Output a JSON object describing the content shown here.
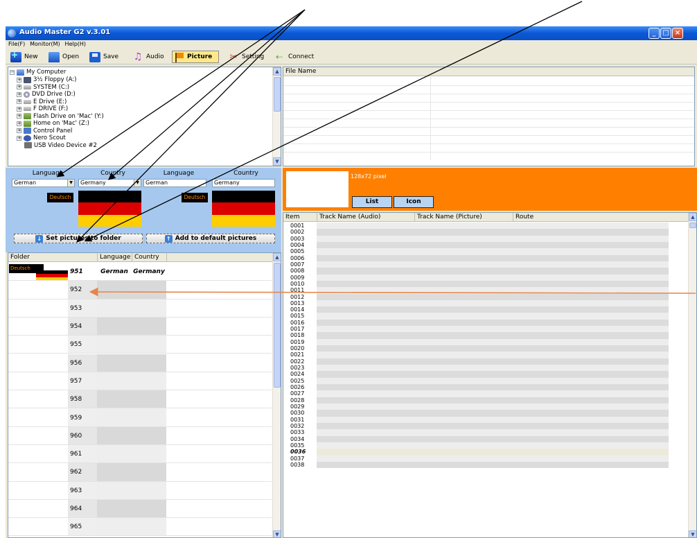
{
  "window": {
    "title": "Audio Master G2 v.3.01",
    "controls": {
      "minimize": "_",
      "maximize": "□",
      "close": "×"
    }
  },
  "menu": [
    "File(F)",
    "Monitor(M)",
    "Help(H)"
  ],
  "toolbar": {
    "new": "New",
    "open": "Open",
    "save": "Save",
    "audio": "Audio",
    "picture": "Picture",
    "setting": "Setting",
    "connect": "Connect"
  },
  "tree": {
    "root": "My Computer",
    "items": [
      "3½ Floppy (A:)",
      "SYSTEM (C:)",
      "DVD Drive (D:)",
      "E Drive (E:)",
      "F DRIVE (F:)",
      "Flash Drive on 'Mac' (Y:)",
      "Home on 'Mac' (Z:)",
      "Control Panel",
      "Nero Scout",
      "USB Video Device #2"
    ]
  },
  "file_list": {
    "header": "File Name"
  },
  "language_panel": {
    "left": {
      "language_label": "Language",
      "country_label": "Country",
      "language_value": "German",
      "country_value": "Germany",
      "badge": "Deutsch"
    },
    "right": {
      "language_label": "Language",
      "country_label": "Country",
      "language_value": "German",
      "country_value": "Germany",
      "badge": "Deutsch"
    },
    "set_button": "Set pictures to folder",
    "add_button": "Add to default pictures"
  },
  "picture_panel": {
    "size_label": "128x72 pixel",
    "list_button": "List",
    "icon_button": "Icon"
  },
  "folder_table": {
    "headers": {
      "folder": "Folder",
      "language": "Language",
      "country": "Country"
    },
    "first_row": {
      "badge": "Deutsch",
      "number": "951",
      "language": "German",
      "country": "Germany"
    },
    "numbers": [
      "952",
      "953",
      "954",
      "955",
      "956",
      "957",
      "958",
      "959",
      "960",
      "961",
      "962",
      "963",
      "964",
      "965"
    ]
  },
  "track_table": {
    "headers": {
      "item": "Item",
      "audio": "Track Name (Audio)",
      "picture": "Track Name (Picture)",
      "route": "Route"
    },
    "items": [
      "0001",
      "0002",
      "0003",
      "0004",
      "0005",
      "0006",
      "0007",
      "0008",
      "0009",
      "0010",
      "0011",
      "0012",
      "0013",
      "0014",
      "0015",
      "0016",
      "0017",
      "0018",
      "0019",
      "0020",
      "0021",
      "0022",
      "0023",
      "0024",
      "0025",
      "0026",
      "0027",
      "0028",
      "0029",
      "0030",
      "0031",
      "0032",
      "0033",
      "0034",
      "0035",
      "0036",
      "0037",
      "0038"
    ],
    "highlighted_item": "0036"
  },
  "colors": {
    "accent_orange": "#ff8000",
    "language_panel_blue": "#a6c8ee",
    "flag_black": "#000000",
    "flag_red": "#dd0000",
    "flag_gold": "#ffce00",
    "annotation_arrow_black": "#000000",
    "annotation_arrow_orange": "#e6864a"
  }
}
